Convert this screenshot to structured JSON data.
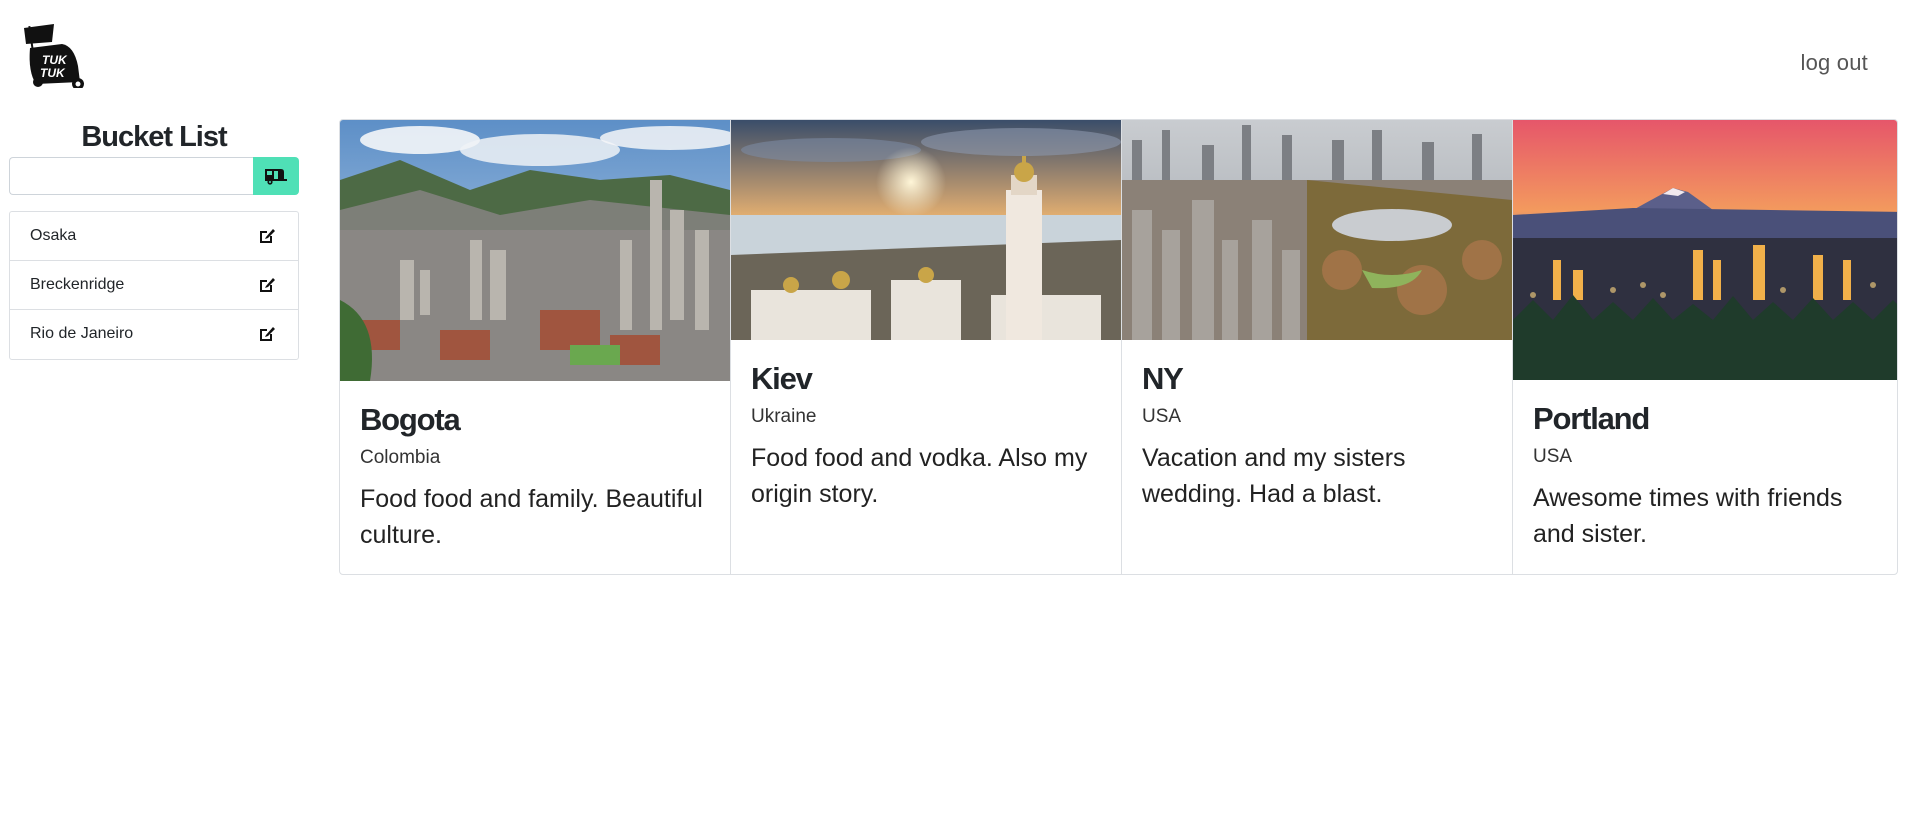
{
  "header": {
    "logo_text_line1": "TUK",
    "logo_text_line2": "TUK",
    "logout_label": "log out"
  },
  "sidebar": {
    "title": "Bucket List",
    "search": {
      "value": "",
      "placeholder": ""
    },
    "add_button_icon": "caravan-icon",
    "accent_color": "#4fe0b6",
    "items": [
      {
        "label": "Osaka",
        "icon": "edit-icon"
      },
      {
        "label": "Breckenridge",
        "icon": "edit-icon"
      },
      {
        "label": "Rio de Janeiro",
        "icon": "edit-icon"
      }
    ]
  },
  "cards": [
    {
      "title": "Bogota",
      "subtitle": "Colombia",
      "text": "Food food and family. Beautiful culture.",
      "image": "bogota-city-photo"
    },
    {
      "title": "Kiev",
      "subtitle": "Ukraine",
      "text": "Food food and vodka. Also my origin story.",
      "image": "kiev-city-photo"
    },
    {
      "title": "NY",
      "subtitle": "USA",
      "text": "Vacation and my sisters wedding. Had a blast.",
      "image": "new-york-city-photo"
    },
    {
      "title": "Portland",
      "subtitle": "USA",
      "text": "Awesome times with friends and sister.",
      "image": "portland-city-photo"
    }
  ]
}
